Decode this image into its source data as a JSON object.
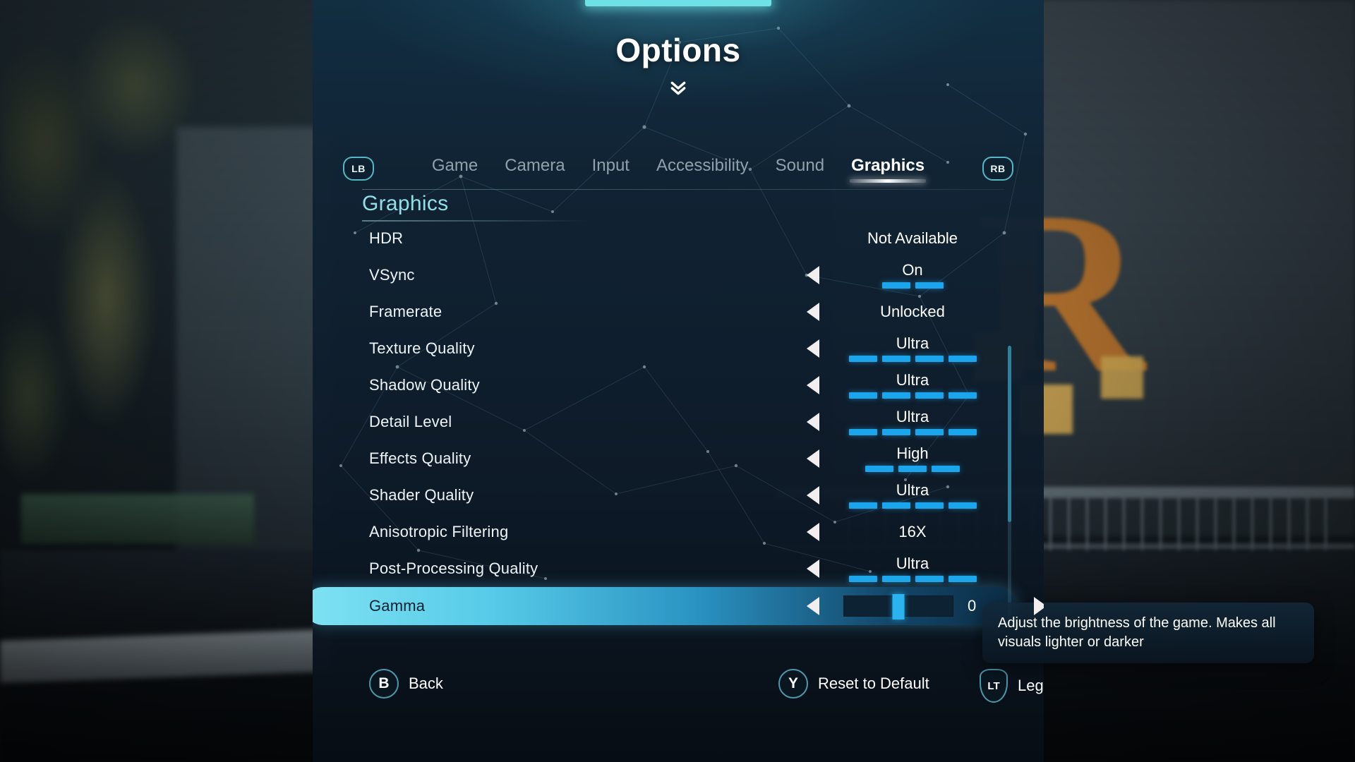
{
  "header": {
    "title": "Options",
    "chevron_icon": "chevron-double-down-icon"
  },
  "tabbar": {
    "left_shoulder": "LB",
    "right_shoulder": "RB",
    "tabs": [
      {
        "label": "Game",
        "active": false
      },
      {
        "label": "Camera",
        "active": false
      },
      {
        "label": "Input",
        "active": false
      },
      {
        "label": "Accessibility",
        "active": false
      },
      {
        "label": "Sound",
        "active": false
      },
      {
        "label": "Graphics",
        "active": true
      }
    ]
  },
  "section": {
    "heading": "Graphics"
  },
  "settings": [
    {
      "label": "HDR",
      "value": "Not Available",
      "arrows": false,
      "segments": 0,
      "filled": 0
    },
    {
      "label": "VSync",
      "value": "On",
      "arrows": true,
      "segments": 2,
      "filled": 2
    },
    {
      "label": "Framerate",
      "value": "Unlocked",
      "arrows": true,
      "segments": 0,
      "filled": 0
    },
    {
      "label": "Texture Quality",
      "value": "Ultra",
      "arrows": true,
      "segments": 4,
      "filled": 4
    },
    {
      "label": "Shadow Quality",
      "value": "Ultra",
      "arrows": true,
      "segments": 4,
      "filled": 4
    },
    {
      "label": "Detail Level",
      "value": "Ultra",
      "arrows": true,
      "segments": 4,
      "filled": 4
    },
    {
      "label": "Effects Quality",
      "value": "High",
      "arrows": true,
      "segments": 3,
      "filled": 3
    },
    {
      "label": "Shader Quality",
      "value": "Ultra",
      "arrows": true,
      "segments": 4,
      "filled": 4
    },
    {
      "label": "Anisotropic Filtering",
      "value": "16X",
      "arrows": true,
      "segments": 0,
      "filled": 0
    },
    {
      "label": "Post-Processing Quality",
      "value": "Ultra",
      "arrows": true,
      "segments": 4,
      "filled": 4
    }
  ],
  "selected_setting": {
    "label": "Gamma",
    "value": "0",
    "slider_position_percent": 50
  },
  "tooltip": {
    "text": "Adjust the brightness of the game. Makes all visuals lighter or darker"
  },
  "footer": {
    "prompts": [
      {
        "button": "B",
        "label": "Back",
        "shape": "circle"
      },
      {
        "button": "Y",
        "label": "Reset to Default",
        "shape": "circle"
      },
      {
        "button": "LT",
        "label": "Legal",
        "shape": "trigger"
      }
    ]
  },
  "colors": {
    "accent_cyan": "#6fe0e6",
    "section_heading": "#93dfe8",
    "segment_filled": "#1ba5ec",
    "segment_empty": "#5b646c",
    "highlight_gradient_start": "#7fe2f3",
    "prompt_ring": "#4e97ab"
  }
}
